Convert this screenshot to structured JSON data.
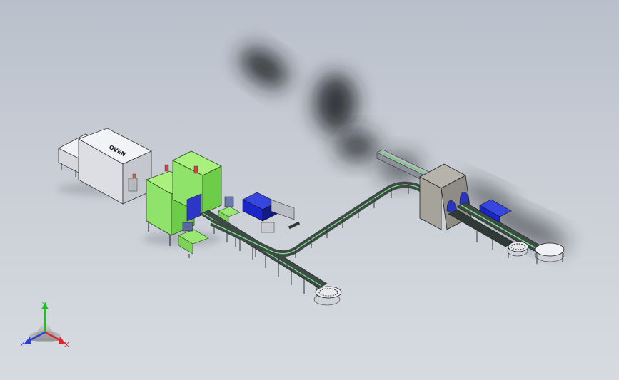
{
  "window": {
    "background_top": "#b9c0cb",
    "background_bottom": "#d7dbe1"
  },
  "scene": {
    "oven_label": "OVEN",
    "colors": {
      "machine_green": "#8fe36a",
      "machine_green_dark": "#5fbf3c",
      "machine_blue": "#1a26c9",
      "oven_gray": "#e4e5ea",
      "tunnel_gray": "#a5a39a",
      "conveyor_dark": "#3d4a46",
      "conveyor_green": "#7fe08a",
      "smoke": "#222326"
    }
  },
  "triad": {
    "y_label": "Y",
    "x_label": "X",
    "z_label": "Z",
    "y_color": "#1fbf2a",
    "x_color": "#e0262a",
    "z_color": "#2a3ed6"
  }
}
